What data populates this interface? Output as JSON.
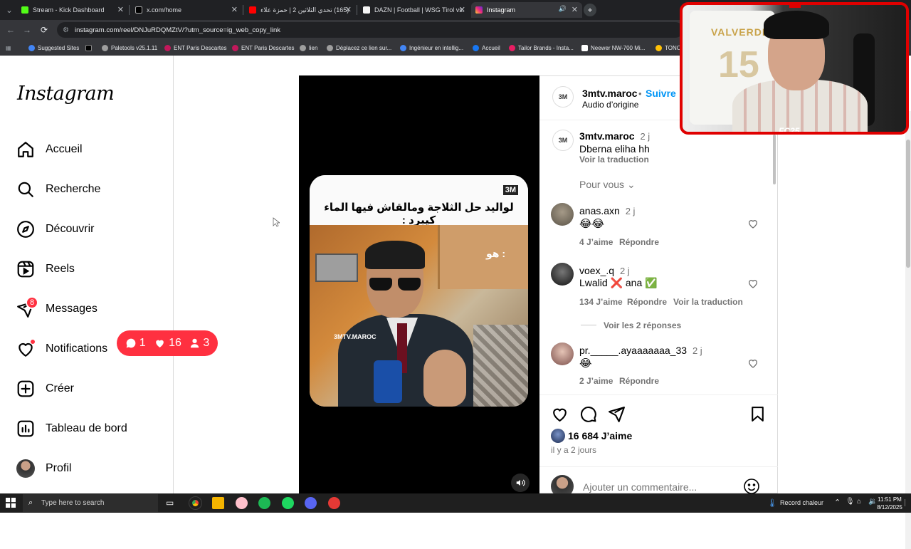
{
  "browser": {
    "tabs": [
      {
        "title": "Stream - Kick Dashboard",
        "favicon_color": "#53fc18",
        "active": false
      },
      {
        "title": "x.com/home",
        "favicon_color": "#000000",
        "active": false
      },
      {
        "title": "(165) تحدي الثلاثين 2 | حمزة علاء",
        "favicon_color": "#ff0000",
        "active": false
      },
      {
        "title": "DAZN | Football | WSG Tirol vs.",
        "favicon_color": "#f5f5f5",
        "active": false
      },
      {
        "title": "Instagram",
        "favicon_color": "#e1306c",
        "active": true
      }
    ],
    "new_tab_label": "+",
    "url": "instagram.com/reel/DNJuRDQMZtV/?utm_source=ig_web_copy_link",
    "bookmarks": [
      {
        "label": "Suggested Sites",
        "color": "#4285f4"
      },
      {
        "label": "",
        "color": "#000000"
      },
      {
        "label": "Paletools v25.1.11",
        "color": "#9e9e9e"
      },
      {
        "label": "ENT Paris Descartes",
        "color": "#c2185b"
      },
      {
        "label": "ENT Paris Descartes",
        "color": "#c2185b"
      },
      {
        "label": "lien",
        "color": "#9e9e9e"
      },
      {
        "label": "Déplacez ce lien sur...",
        "color": "#9e9e9e"
      },
      {
        "label": "Ingénieur en intellig...",
        "color": "#4285f4"
      },
      {
        "label": "Accueil",
        "color": "#1877f2"
      },
      {
        "label": "Tailor Brands - Insta...",
        "color": "#e91e63"
      },
      {
        "label": "Neewer NW-700 Mi...",
        "color": "#ffffff"
      },
      {
        "label": "TONO",
        "color": "#ffc107"
      }
    ]
  },
  "instagram": {
    "logo": "Instagram",
    "nav": [
      {
        "label": "Accueil",
        "icon": "home-icon"
      },
      {
        "label": "Recherche",
        "icon": "search-icon"
      },
      {
        "label": "Découvrir",
        "icon": "compass-icon"
      },
      {
        "label": "Reels",
        "icon": "reels-icon"
      },
      {
        "label": "Messages",
        "icon": "messenger-icon",
        "badge": "8"
      },
      {
        "label": "Notifications",
        "icon": "heart-icon"
      },
      {
        "label": "Créer",
        "icon": "plus-square-icon"
      },
      {
        "label": "Tableau de bord",
        "icon": "dashboard-icon"
      },
      {
        "label": "Profil",
        "icon": "profile-avatar"
      }
    ],
    "notif_popup": {
      "comments": "1",
      "likes": "16",
      "follows": "3"
    },
    "reel": {
      "brand": "3M",
      "caption_arabic": "لواليد حل الثلاجة ومالقاش فيها الماء كيبرد :",
      "overlay_text": "هو :",
      "watermark": "3MTV.MAROC"
    },
    "post": {
      "author": "3mtv.maroc",
      "separator": "•",
      "follow": "Suivre",
      "audio": "Audio d’origine",
      "caption": {
        "user": "3mtv.maroc",
        "time": "2 j",
        "text": "Dberna eliha hh",
        "translate": "Voir la traduction"
      },
      "pour_vous": "Pour vous",
      "comments": [
        {
          "user": "anas.axn",
          "time": "2 j",
          "text": "😂😂",
          "likes": "4 J’aime",
          "reply": "Répondre",
          "translate": ""
        },
        {
          "user": "voex_.q",
          "time": "2 j",
          "text": "Lwalid ❌ ana ✅",
          "likes": "134 J’aime",
          "reply": "Répondre",
          "translate": "Voir la traduction"
        },
        {
          "user": "pr._____.ayaaaaaaa_33",
          "time": "2 j",
          "text": "😂",
          "likes": "2 J’aime",
          "reply": "Répondre",
          "translate": ""
        }
      ],
      "view_replies": "Voir les 2 réponses",
      "like_count": "16 684 J’aime",
      "posted": "il y a 2 jours",
      "comment_placeholder": "Ajouter un commentaire..."
    }
  },
  "webcam": {
    "jersey_name": "VALVERDE",
    "jersey_number": "15",
    "game_logo": "FC25"
  },
  "taskbar": {
    "search_placeholder": "Type here to search",
    "tray_text": "Record chaleur",
    "time": "11:51 PM",
    "date": "8/12/2025"
  }
}
